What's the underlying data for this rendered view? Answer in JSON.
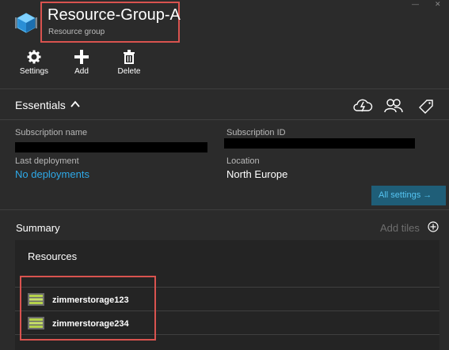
{
  "header": {
    "title": "Resource-Group-A",
    "subtitle": "Resource group",
    "commands": [
      {
        "label": "Settings",
        "icon": "gear-icon"
      },
      {
        "label": "Add",
        "icon": "plus-icon"
      },
      {
        "label": "Delete",
        "icon": "trash-icon"
      }
    ]
  },
  "essentials": {
    "title": "Essentials",
    "fields": {
      "subscription_name": {
        "label": "Subscription name",
        "value": ""
      },
      "subscription_id": {
        "label": "Subscription ID",
        "value": ""
      },
      "last_deployment": {
        "label": "Last deployment",
        "value": "No deployments"
      },
      "location": {
        "label": "Location",
        "value": "North Europe"
      }
    },
    "all_settings": "All settings →",
    "icons": [
      "cloud-icon",
      "users-icon",
      "tag-icon"
    ]
  },
  "summary": {
    "title": "Summary",
    "add_tiles": "Add tiles",
    "resources": {
      "title": "Resources",
      "items": [
        {
          "name": "zimmerstorage123",
          "icon": "storage-icon"
        },
        {
          "name": "zimmerstorage234",
          "icon": "storage-icon"
        }
      ]
    }
  },
  "colors": {
    "background": "#2b2b2b",
    "tile": "#242424",
    "link": "#2ea9e8",
    "accent_button": "#1f5e78",
    "highlight": "#d9534f"
  }
}
